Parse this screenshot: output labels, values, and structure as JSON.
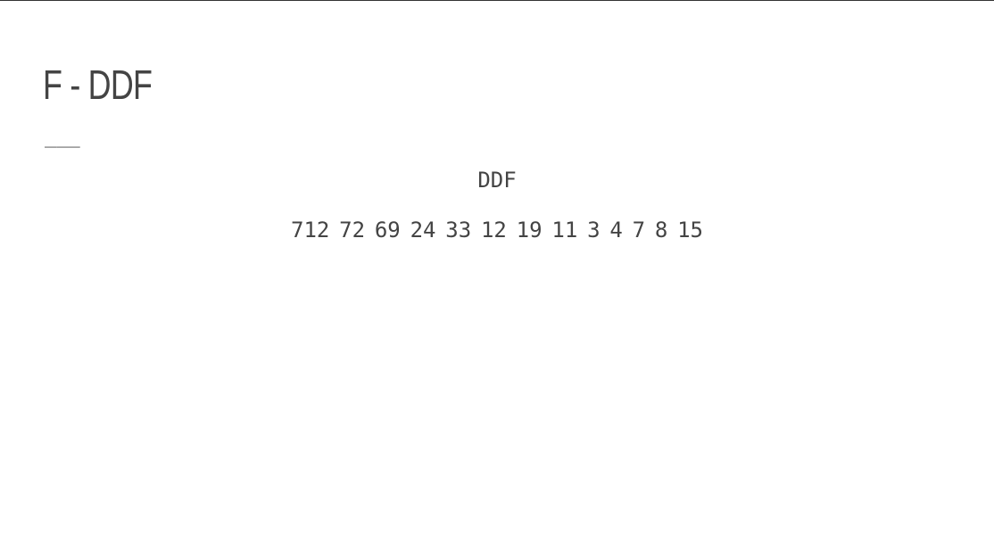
{
  "slide": {
    "title": "F - DDF",
    "divider": "___"
  },
  "content": {
    "heading": "DDF",
    "values": [
      "712",
      "72",
      "69",
      "24",
      "33",
      "12",
      "19",
      "11",
      "3",
      "4",
      "7",
      "8",
      "15"
    ]
  }
}
